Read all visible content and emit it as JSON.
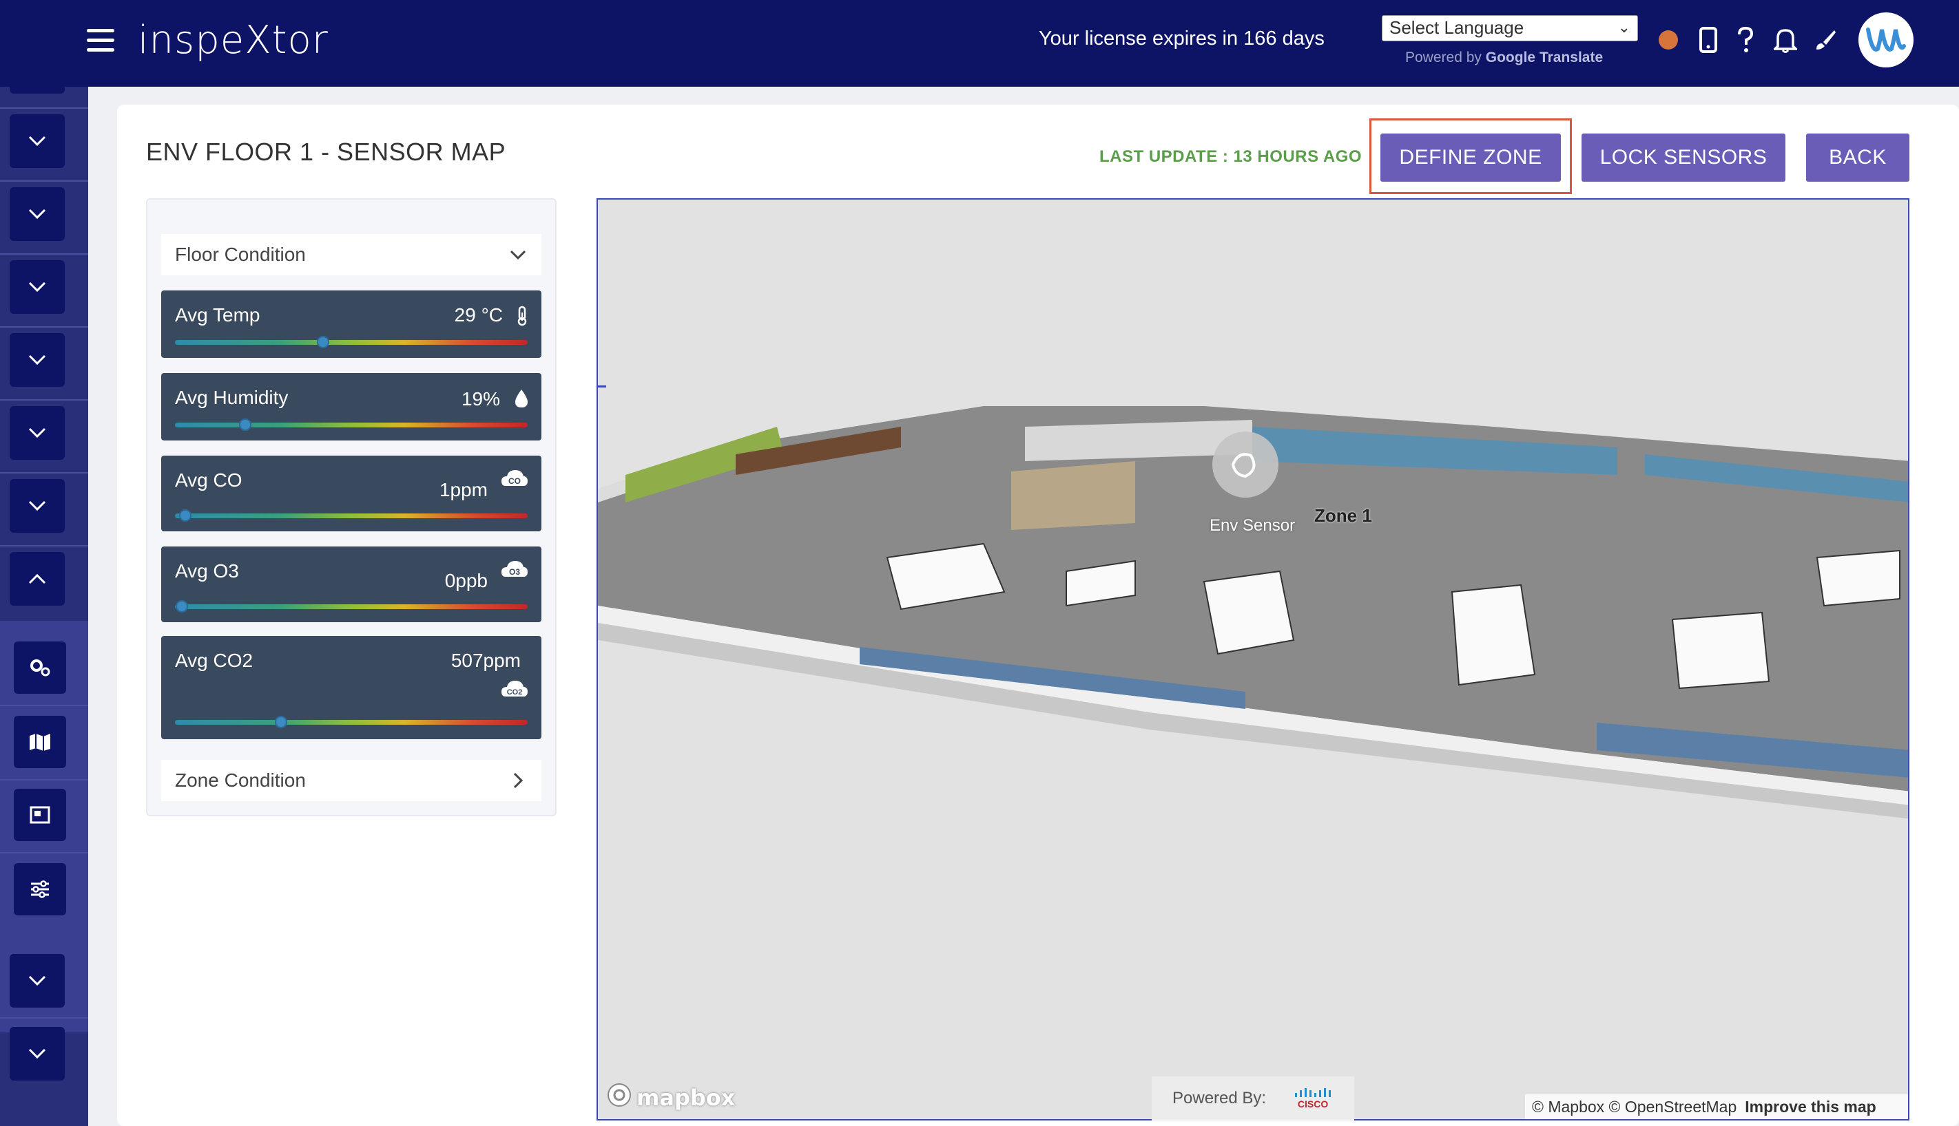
{
  "header": {
    "brand": "inspeXtor",
    "license_text": "Your license expires in 166 days",
    "language_select": "Select Language",
    "powered_by": "Powered by",
    "google": "Google",
    "translate": "Translate",
    "status_color": "#d6743c"
  },
  "page": {
    "title": "ENV FLOOR 1 - SENSOR MAP",
    "last_update": "LAST UPDATE : 13 HOURS AGO",
    "buttons": {
      "define_zone": "DEFINE ZONE",
      "lock_sensors": "LOCK SENSORS",
      "back": "BACK"
    },
    "accent_color": "#6a5db8"
  },
  "panel": {
    "floor_condition": "Floor Condition",
    "zone_condition": "Zone Condition",
    "metrics": [
      {
        "label": "Avg Temp",
        "value": "29 °C",
        "icon": "thermometer-icon",
        "level": 0.42
      },
      {
        "label": "Avg Humidity",
        "value": "19%",
        "icon": "droplet-icon",
        "level": 0.2
      },
      {
        "label": "Avg CO",
        "value": "1ppm",
        "icon": "co-cloud-icon",
        "icon_text": "CO",
        "level": 0.03
      },
      {
        "label": "Avg O3",
        "value": "0ppb",
        "icon": "o3-cloud-icon",
        "icon_text": "O3",
        "level": 0.02
      },
      {
        "label": "Avg CO2",
        "value": "507ppm",
        "icon": "co2-cloud-icon",
        "icon_text": "CO2",
        "level": 0.3
      }
    ]
  },
  "map": {
    "sensor_label": "Env Sensor",
    "zone_label": "Zone 1",
    "mapbox": "mapbox",
    "powered_by": "Powered By:",
    "cisco": "CISCO",
    "attribution": "© Mapbox © OpenStreetMap",
    "improve": "Improve this map"
  }
}
